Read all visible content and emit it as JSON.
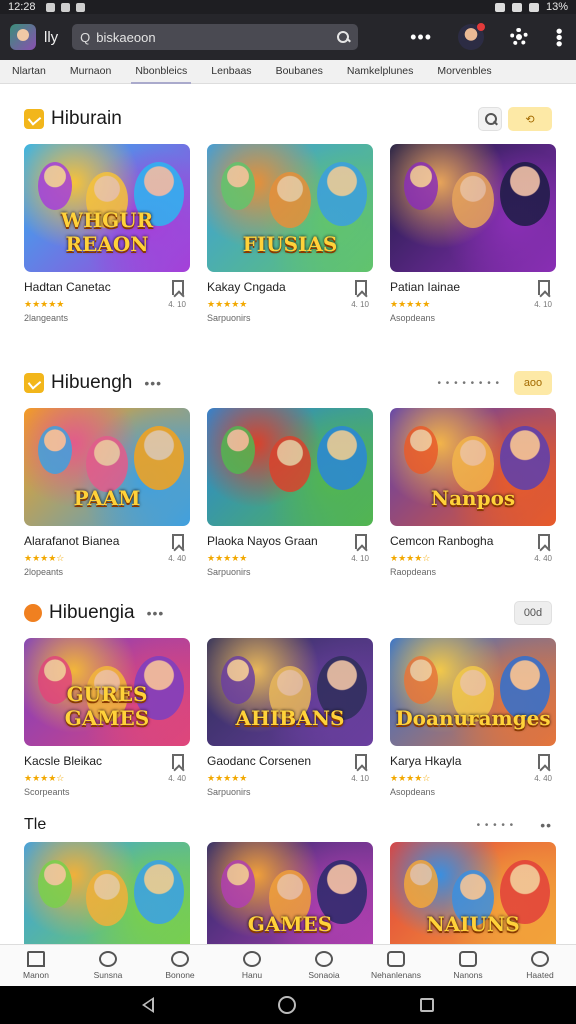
{
  "status_bar": {
    "time": "12:28",
    "battery": "13%"
  },
  "topbar": {
    "app_name": "lly",
    "search_lead": "Q",
    "search_placeholder": "biskaeoon"
  },
  "tabs": [
    "Nlartan",
    "Murnaon",
    "Nbonbleics",
    "Lenbaas",
    "Boubanes",
    "Namkelplunes",
    "Morvenbles"
  ],
  "sections": [
    {
      "title": "Hiburain",
      "right_pill": "",
      "cards": [
        {
          "title": "Hadtan Canetac",
          "stars": "★★★★★",
          "meta": "4. 10",
          "sub": "2langeants",
          "thumb_text": "WHGUR REAON",
          "colors": [
            "#2db5f0",
            "#a63fd8",
            "#f6c23a"
          ]
        },
        {
          "title": "Kakay Cngada",
          "stars": "★★★★★",
          "meta": "4. 10",
          "sub": "Sarpuonirs",
          "thumb_text": "FIUSIAS",
          "colors": [
            "#3b9ee0",
            "#62c46b",
            "#e58f3a"
          ]
        },
        {
          "title": "Patian Iainae",
          "stars": "★★★★★",
          "meta": "4. 10",
          "sub": "Asopdeans",
          "thumb_text": "",
          "colors": [
            "#1c1c44",
            "#8a2fb5",
            "#e7a45a"
          ]
        }
      ]
    },
    {
      "title": "Hibuengh",
      "right_pill": "aoo",
      "cards": [
        {
          "title": "Alarafanot Bianea",
          "stars": "★★★★☆",
          "meta": "4. 40",
          "sub": "2lopeants",
          "thumb_text": "PAAM",
          "colors": [
            "#f6a21b",
            "#3fa0e0",
            "#e25b8b"
          ]
        },
        {
          "title": "Plaoka Nayos Graan",
          "stars": "★★★★★",
          "meta": "4. 10",
          "sub": "Sarpuonirs",
          "thumb_text": "",
          "colors": [
            "#2a86d8",
            "#53b64f",
            "#d9422c"
          ]
        },
        {
          "title": "Cemcon Ranbogha",
          "stars": "★★★★☆",
          "meta": "4. 40",
          "sub": "Raopdeans",
          "thumb_text": "Nanpos",
          "colors": [
            "#5a3fb0",
            "#e85b2a",
            "#f2b44a"
          ]
        }
      ]
    },
    {
      "title": "Hibuengia",
      "right_pill": "00d",
      "cards": [
        {
          "title": "Kacsle Bleikac",
          "stars": "★★★★☆",
          "meta": "4. 40",
          "sub": "Scorpeants",
          "thumb_text": "GURES GAMES",
          "colors": [
            "#7c3fc0",
            "#e0467a",
            "#f2b63a"
          ]
        },
        {
          "title": "Gaodanc Corsenen",
          "stars": "★★★★★",
          "meta": "4. 10",
          "sub": "Sarpuonirs",
          "thumb_text": "AHIBANS",
          "colors": [
            "#2e2e5a",
            "#6b3fa0",
            "#e8b75a"
          ]
        },
        {
          "title": "Karya Hkayla",
          "stars": "★★★★☆",
          "meta": "4. 40",
          "sub": "Asopdeans",
          "thumb_text": "Doanuramges",
          "colors": [
            "#2f6fd0",
            "#e6753a",
            "#f2c84a"
          ]
        }
      ]
    },
    {
      "title": "Tle",
      "right_pill": "",
      "cards": [
        {
          "title": "",
          "stars": "",
          "meta": "",
          "sub": "",
          "thumb_text": "",
          "colors": [
            "#3aa0e8",
            "#7ad04a",
            "#f0b03a"
          ]
        },
        {
          "title": "",
          "stars": "",
          "meta": "",
          "sub": "",
          "thumb_text": "GAMES",
          "colors": [
            "#2a2a6a",
            "#b03fb0",
            "#f0a03a"
          ]
        },
        {
          "title": "",
          "stars": "",
          "meta": "",
          "sub": "",
          "thumb_text": "NAIUNS",
          "colors": [
            "#e2403a",
            "#f3a73a",
            "#3a8fe0"
          ]
        }
      ]
    }
  ],
  "bottom_nav": [
    "Manon",
    "Sunsna",
    "Bonone",
    "Hanu",
    "Sonaoia",
    "Nehanlenans",
    "Nanons",
    "Haated"
  ]
}
